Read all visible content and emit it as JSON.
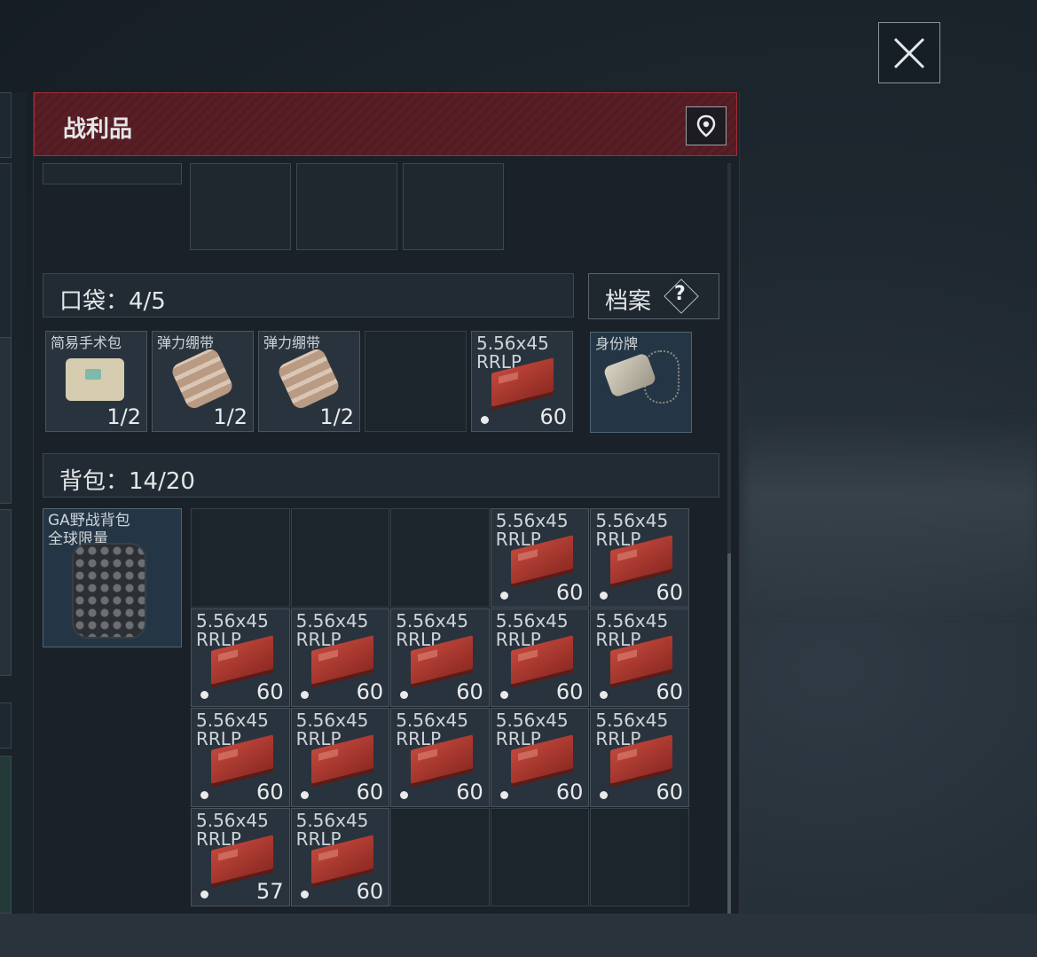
{
  "panel": {
    "title": "战利品"
  },
  "pockets": {
    "label": "口袋：4/5"
  },
  "archive": {
    "label": "档案",
    "help": "?"
  },
  "backpack": {
    "label": "背包：14/20",
    "equipped": {
      "name_line1": "GA野战背包",
      "name_line2": "全球限量"
    }
  },
  "pocket_items": [
    {
      "name": "简易手术包",
      "count": "1/2",
      "icon": "medkit-icon"
    },
    {
      "name": "弹力绷带",
      "count": "1/2",
      "icon": "bandage-icon"
    },
    {
      "name": "弹力绷带",
      "count": "1/2",
      "icon": "bandage-icon"
    },
    {
      "name": "",
      "count": "",
      "icon": "empty"
    },
    {
      "name_line1": "5.56x45",
      "name_line2": "RRLP",
      "count": "60",
      "icon": "ammo-icon"
    }
  ],
  "dog_tag": {
    "name": "身份牌"
  },
  "ammo": {
    "line1": "5.56x45",
    "line2": "RRLP"
  },
  "backpack_counts": [
    "60",
    "60",
    "60",
    "60",
    "60",
    "60",
    "60",
    "60",
    "60",
    "60",
    "60",
    "60",
    "57",
    "60",
    "60"
  ],
  "icons": {
    "close": "close-icon",
    "pin": "location-pin-icon"
  },
  "colors": {
    "header": "#5a1f26",
    "header_border": "#a12f39",
    "ammo": "#b8413a"
  }
}
